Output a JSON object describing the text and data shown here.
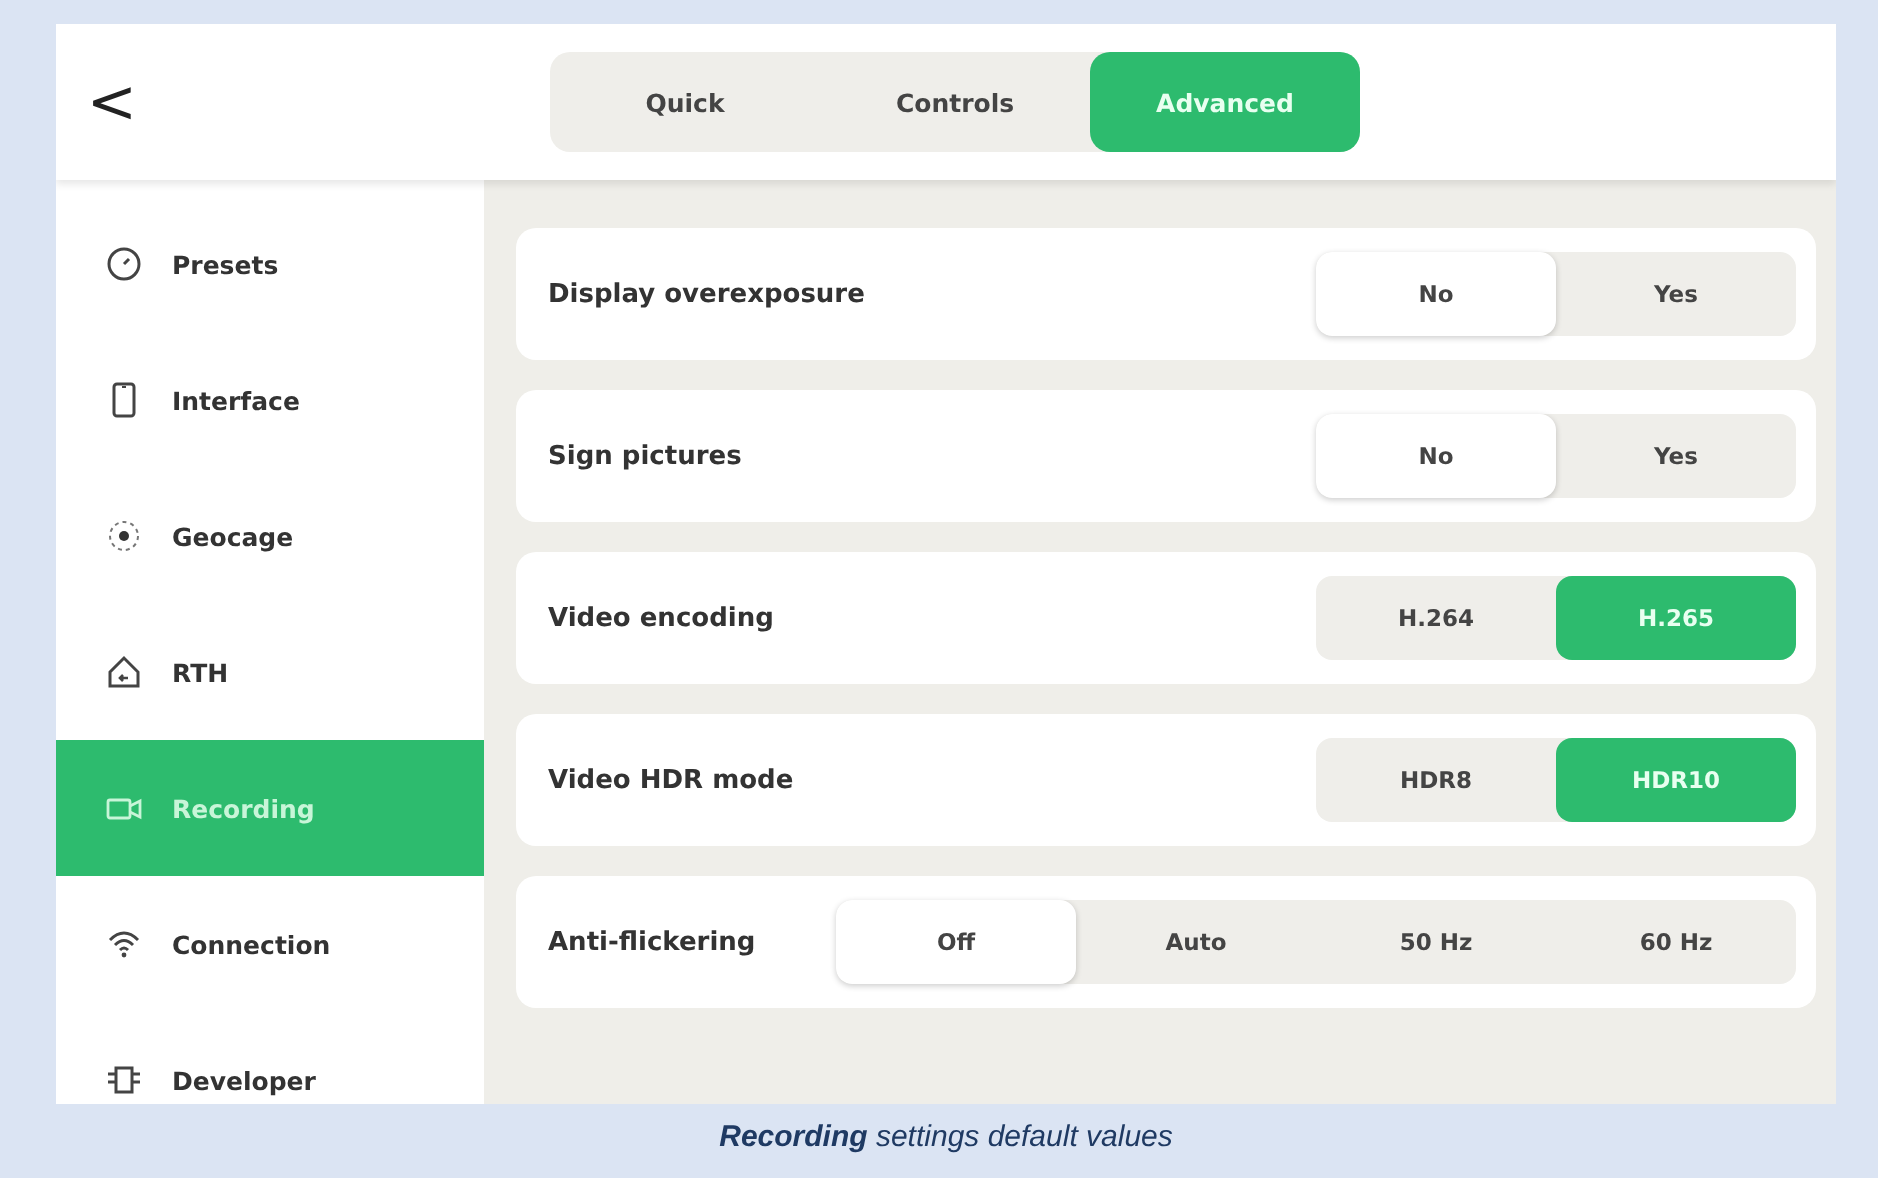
{
  "header": {
    "back": "<",
    "tabs": [
      {
        "label": "Quick",
        "selected": false
      },
      {
        "label": "Controls",
        "selected": false
      },
      {
        "label": "Advanced",
        "selected": true
      }
    ]
  },
  "sidebar": {
    "items": [
      {
        "label": "Presets",
        "selected": false
      },
      {
        "label": "Interface",
        "selected": false
      },
      {
        "label": "Geocage",
        "selected": false
      },
      {
        "label": "RTH",
        "selected": false
      },
      {
        "label": "Recording",
        "selected": true
      },
      {
        "label": "Connection",
        "selected": false
      },
      {
        "label": "Developer",
        "selected": false
      }
    ]
  },
  "settings": [
    {
      "label": "Display overexposure",
      "kind": "switch",
      "options": [
        {
          "label": "No",
          "selected": true
        },
        {
          "label": "Yes",
          "selected": false
        }
      ]
    },
    {
      "label": "Sign pictures",
      "kind": "switch",
      "options": [
        {
          "label": "No",
          "selected": true
        },
        {
          "label": "Yes",
          "selected": false
        }
      ]
    },
    {
      "label": "Video encoding",
      "kind": "choice",
      "options": [
        {
          "label": "H.264",
          "selected": false
        },
        {
          "label": "H.265",
          "selected": true
        }
      ]
    },
    {
      "label": "Video HDR mode",
      "kind": "choice",
      "options": [
        {
          "label": "HDR8",
          "selected": false
        },
        {
          "label": "HDR10",
          "selected": true
        }
      ]
    },
    {
      "label": "Anti-flickering",
      "kind": "switch",
      "options": [
        {
          "label": "Off",
          "selected": true
        },
        {
          "label": "Auto",
          "selected": false
        },
        {
          "label": "50 Hz",
          "selected": false
        },
        {
          "label": "60 Hz",
          "selected": false
        }
      ]
    }
  ],
  "caption": "**Recording** settings default values"
}
